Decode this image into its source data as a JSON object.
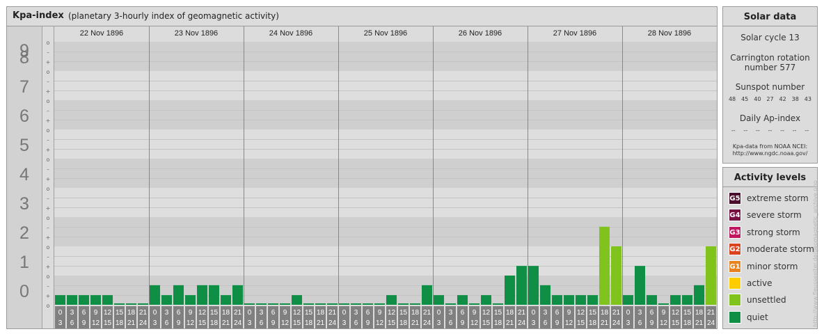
{
  "header": {
    "title": "Kpa-index",
    "subtitle": "(planetary 3-hourly index of geomagnetic activity)"
  },
  "chart_data": {
    "type": "bar",
    "title": "Kpa-index",
    "subtitle": "(planetary 3-hourly index of geomagnetic activity)",
    "ylim": [
      0,
      9
    ],
    "y_ticks": [
      "0",
      "1",
      "2",
      "3",
      "4",
      "5",
      "6",
      "7",
      "8",
      "9"
    ],
    "sub_ticks": [
      "o",
      "+",
      "–"
    ],
    "days": [
      "22 Nov 1896",
      "23 Nov 1896",
      "24 Nov 1896",
      "25 Nov 1896",
      "26 Nov 1896",
      "27 Nov 1896",
      "28 Nov 1896"
    ],
    "hour_start": [
      "0",
      "3",
      "6",
      "9",
      "12",
      "15",
      "18",
      "21"
    ],
    "hour_end": [
      "3",
      "6",
      "9",
      "12",
      "15",
      "18",
      "21",
      "24"
    ],
    "values": [
      [
        0.33,
        0.33,
        0.33,
        0.33,
        0.33,
        0,
        0,
        0
      ],
      [
        0.67,
        0.33,
        0.67,
        0.33,
        0.67,
        0.67,
        0.33,
        0.67
      ],
      [
        0,
        0,
        0,
        0,
        0.33,
        0,
        0,
        0
      ],
      [
        0,
        0,
        0,
        0,
        0.33,
        0,
        0,
        0.67
      ],
      [
        0.33,
        0,
        0.33,
        0,
        0.33,
        0,
        1,
        1.33
      ],
      [
        1.33,
        0.67,
        0.33,
        0.33,
        0.33,
        0.33,
        2.67,
        2
      ],
      [
        0.33,
        1.33,
        0.33,
        0,
        0.33,
        0.33,
        0.67,
        2
      ]
    ],
    "level_colors": {
      "quiet": "#0e8f45",
      "unsettled": "#7fc31c",
      "active": "#ffcc00",
      "G1": "#e98221",
      "G2": "#d9441f",
      "G3": "#c0155f",
      "G4": "#781043",
      "G5": "#4a0e2a"
    }
  },
  "solar": {
    "title": "Solar data",
    "cycle": "Solar cycle 13",
    "carrington_1": "Carrington rotation",
    "carrington_2": "number 577",
    "sunspot_title": "Sunspot number",
    "sunspots": [
      "48",
      "45",
      "40",
      "27",
      "42",
      "38",
      "43"
    ],
    "ap_title": "Daily Ap-index",
    "ap_values": [
      "--",
      "--",
      "--",
      "--",
      "--",
      "--",
      "--"
    ],
    "source_1": "Kpa-data from NOAA NCEI:",
    "source_2": "http://www.ngdc.noaa.gov/"
  },
  "activity": {
    "title": "Activity levels",
    "items": [
      {
        "badge": "G5",
        "label": "extreme storm",
        "color": "#4a0e2a"
      },
      {
        "badge": "G4",
        "label": "severe storm",
        "color": "#781043"
      },
      {
        "badge": "G3",
        "label": "strong storm",
        "color": "#c0155f"
      },
      {
        "badge": "G2",
        "label": "moderate storm",
        "color": "#d9441f"
      },
      {
        "badge": "G1",
        "label": "minor storm",
        "color": "#e98221"
      },
      {
        "badge": "",
        "label": "active",
        "color": "#ffcc00"
      },
      {
        "badge": "",
        "label": "unsettled",
        "color": "#7fc31c"
      },
      {
        "badge": "",
        "label": "quiet",
        "color": "#0e8f45"
      }
    ]
  },
  "credit": "http://www.fleusseeiter.de/geomagnetic_archive.php"
}
